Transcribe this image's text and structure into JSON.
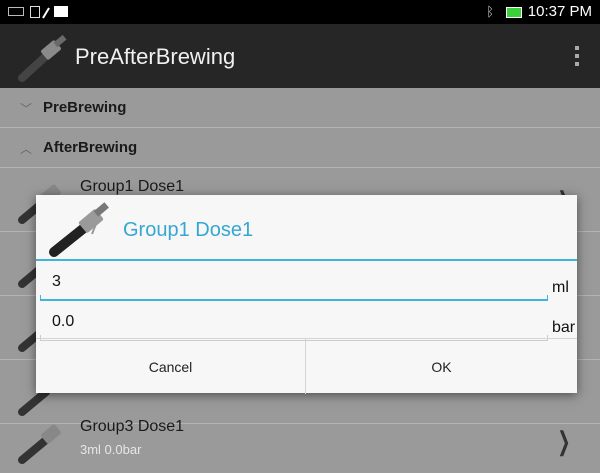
{
  "status_bar": {
    "time": "10:37 PM",
    "icons": [
      "keyboard-icon",
      "clipboard-icon",
      "pen-icon",
      "image-icon",
      "bluetooth-icon",
      "battery-icon"
    ]
  },
  "action_bar": {
    "title": "PreAfterBrewing",
    "logo_icon": "portafilter-icon",
    "menu_icon": "overflow-menu-icon"
  },
  "groups": [
    {
      "label": "PreBrewing",
      "expanded": false
    },
    {
      "label": "AfterBrewing",
      "expanded": true
    }
  ],
  "items": [
    {
      "title": "Group1 Dose1",
      "subtitle": ""
    },
    {
      "title": "",
      "subtitle": ""
    },
    {
      "title": "",
      "subtitle": ""
    },
    {
      "title": "",
      "subtitle": ""
    },
    {
      "title": "Group3 Dose1",
      "subtitle": "3ml  0.0bar"
    }
  ],
  "dialog": {
    "title": "Group1 Dose1",
    "volume": {
      "value": "3",
      "unit": "ml"
    },
    "pressure": {
      "value": "0.0",
      "unit": "bar"
    },
    "cancel_label": "Cancel",
    "ok_label": "OK"
  },
  "colors": {
    "accent": "#35a7d3",
    "action_bar": "#262626",
    "list_bg": "#9a9a9a"
  }
}
